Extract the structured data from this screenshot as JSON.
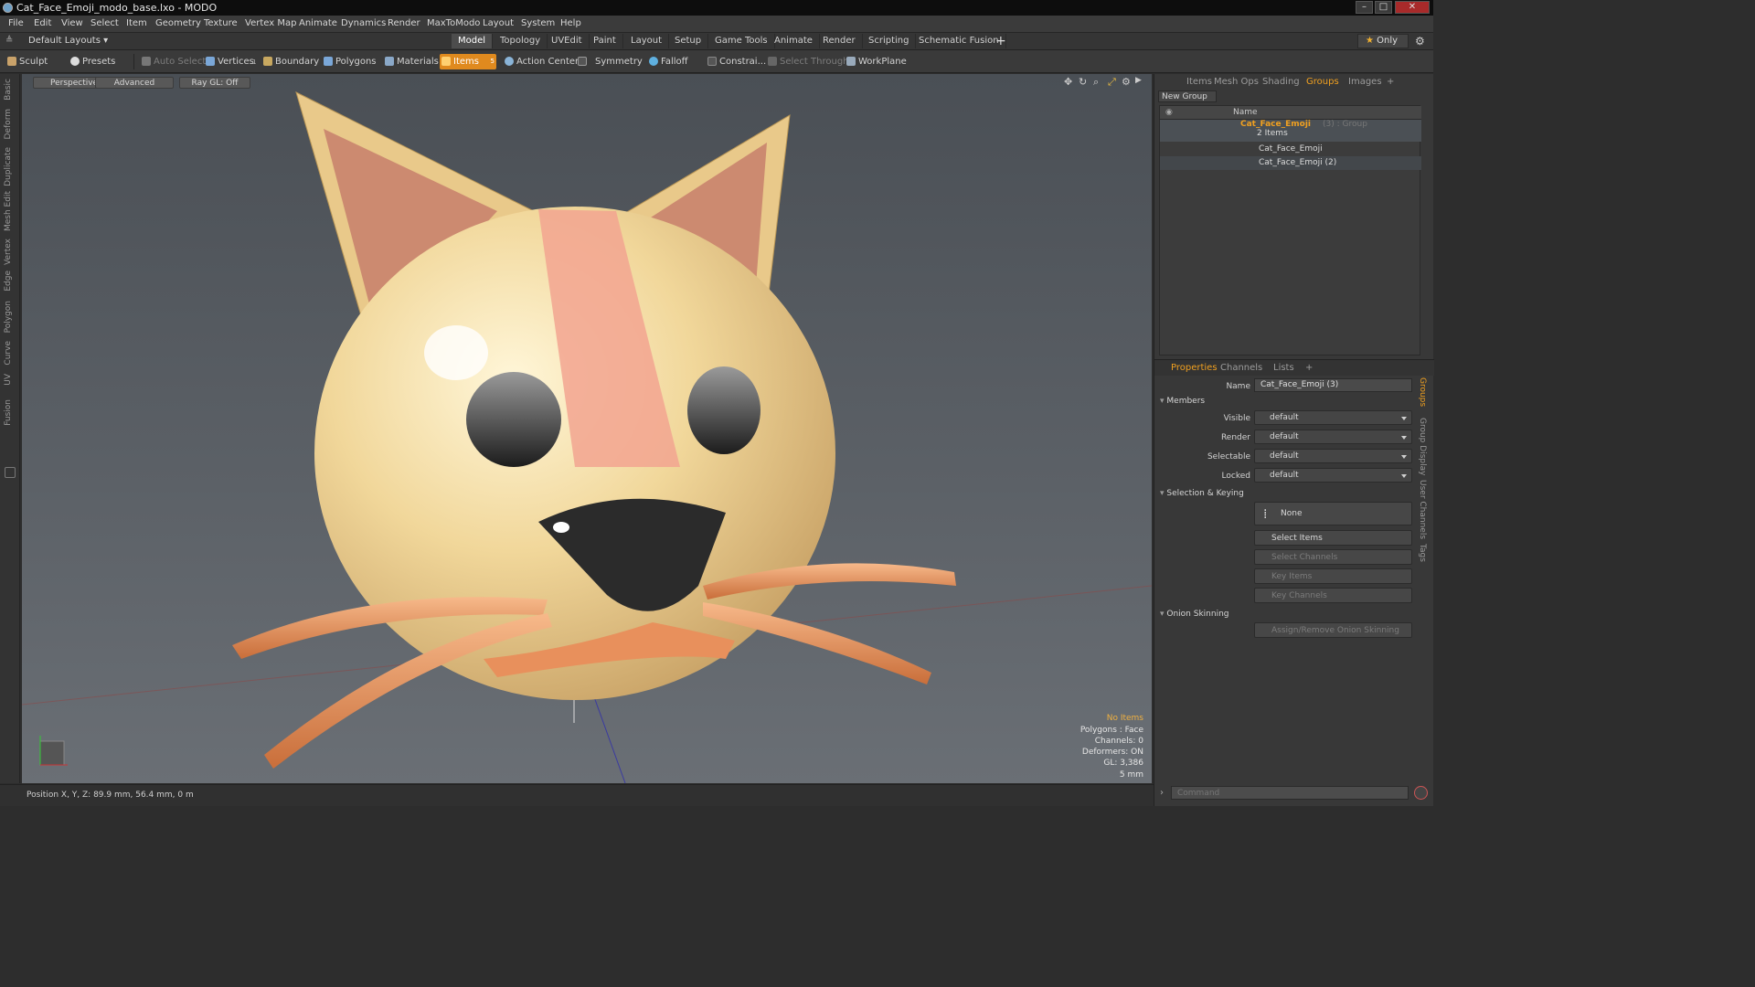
{
  "window": {
    "title": "Cat_Face_Emoji_modo_base.lxo - MODO",
    "controls": [
      "–",
      "□",
      "✕"
    ]
  },
  "menu": [
    "File",
    "Edit",
    "View",
    "Select",
    "Item",
    "Geometry",
    "Texture",
    "Vertex Map",
    "Animate",
    "Dynamics",
    "Render",
    "MaxToModo",
    "Layout",
    "System",
    "Help"
  ],
  "layouts": {
    "label": "Default Layouts ▾",
    "tabs": [
      "Model",
      "Topology",
      "UVEdit",
      "Paint",
      "Layout",
      "Setup",
      "Game Tools",
      "Animate",
      "Render",
      "Scripting",
      "Schematic Fusion"
    ],
    "active": "Model",
    "add": "+",
    "only": "Only"
  },
  "toolbar": {
    "sculpt": "Sculpt",
    "presets": "Presets",
    "auto_select": "Auto Select",
    "vertices": "Vertices",
    "vertices_badge": "1",
    "boundary": "Boundary",
    "polygons": "Polygons",
    "materials": "Materials",
    "items": "Items",
    "items_badge": "5",
    "action_center": "Action Center",
    "symmetry": "Symmetry",
    "falloff": "Falloff",
    "constrain": "Constrai...",
    "select_through": "Select Through",
    "workplane": "WorkPlane"
  },
  "left_tabs": [
    "Basic",
    "Deform",
    "Duplicate",
    "Mesh Edit",
    "Vertex",
    "Edge",
    "Polygon",
    "Curve",
    "UV",
    "Fusion"
  ],
  "viewport": {
    "view": "Perspective",
    "shading": "Advanced",
    "raygl": "Ray GL: Off",
    "info": {
      "selection": "No Items",
      "polygons": "Polygons : Face",
      "channels": "Channels: 0",
      "deformers": "Deformers: ON",
      "gl": "GL: 3,386",
      "scale": "5 mm"
    }
  },
  "status": {
    "position": "Position X, Y, Z:  89.9 mm, 56.4 mm, 0 m"
  },
  "top_panel": {
    "tabs": [
      "Items",
      "Mesh Ops",
      "Shading",
      "Groups",
      "Images",
      "+"
    ],
    "active": "Groups",
    "new_group": "New Group",
    "col_name": "Name",
    "group": {
      "name": "Cat_Face_Emoji",
      "suffix": "(3) : Group",
      "count": "2 Items",
      "children": [
        "Cat_Face_Emoji",
        "Cat_Face_Emoji (2)"
      ]
    }
  },
  "props": {
    "tabs": [
      "Properties",
      "Channels",
      "Lists",
      "+"
    ],
    "active": "Properties",
    "name_label": "Name",
    "name_value": "Cat_Face_Emoji (3)",
    "members": "Members",
    "visible_label": "Visible",
    "render_label": "Render",
    "selectable_label": "Selectable",
    "locked_label": "Locked",
    "default": "default",
    "sel_keying": "Selection & Keying",
    "none": "None",
    "select_items": "Select Items",
    "select_channels": "Select Channels",
    "key_items": "Key Items",
    "key_channels": "Key Channels",
    "onion": "Onion Skinning",
    "assign_onion": "Assign/Remove Onion Skinning",
    "side_tabs": [
      "Groups",
      "Group Display",
      "User Channels",
      "Tags"
    ]
  },
  "command": {
    "placeholder": "Command"
  },
  "colors": {
    "accent": "#e08a1e",
    "cat_body": "#f1d79a",
    "cat_stripe": "#f2a590",
    "whisker": "#e8905c",
    "nose": "#2b2b2b"
  }
}
